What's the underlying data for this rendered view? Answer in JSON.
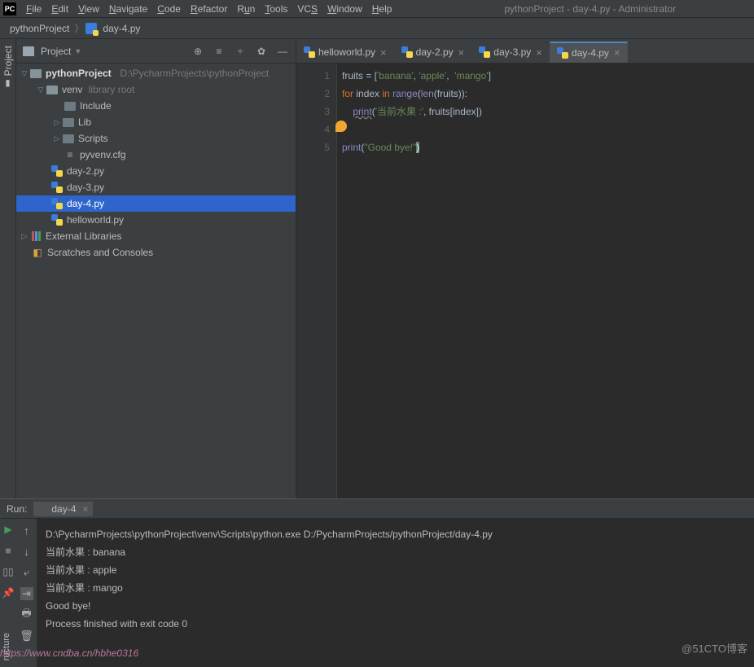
{
  "window_title": "pythonProject - day-4.py - Administrator",
  "menu": [
    "File",
    "Edit",
    "View",
    "Navigate",
    "Code",
    "Refactor",
    "Run",
    "Tools",
    "VCS",
    "Window",
    "Help"
  ],
  "breadcrumb": {
    "root": "pythonProject",
    "file": "day-4.py"
  },
  "project_panel": {
    "title": "Project",
    "root": "pythonProject",
    "root_path": "D:\\PycharmProjects\\pythonProject",
    "venv": "venv",
    "venv_note": "library root",
    "include": "Include",
    "lib": "Lib",
    "scripts": "Scripts",
    "pyvenv": "pyvenv.cfg",
    "files": [
      "day-2.py",
      "day-3.py",
      "day-4.py",
      "helloworld.py"
    ],
    "ext_lib": "External Libraries",
    "scratches": "Scratches and Consoles"
  },
  "tabs": [
    {
      "label": "helloworld.py"
    },
    {
      "label": "day-2.py"
    },
    {
      "label": "day-3.py"
    },
    {
      "label": "day-4.py"
    }
  ],
  "code": {
    "l1_a": "fruits = [",
    "l1_s1": "'banana'",
    "l1_c": ", ",
    "l1_s2": "'apple'",
    "l1_c2": ",  ",
    "l1_s3": "'mango'",
    "l1_b": "]",
    "l2_for": "for",
    "l2_idx": " index ",
    "l2_in": "in",
    "l2_sp": " ",
    "l2_range": "range",
    "l2_p1": "(",
    "l2_len": "len",
    "l2_p2": "(fruits)):",
    "l3_sp": "    ",
    "l3_print": "print",
    "l3_p1": "(",
    "l3_s": "'当前水果 :'",
    "l3_rest": ", fruits[index])",
    "l5_print": "print",
    "l5_p1": "(",
    "l5_s": "\"Good bye!\"",
    "l5_p2": ")"
  },
  "line_numbers": [
    "1",
    "2",
    "3",
    "4",
    "5"
  ],
  "run": {
    "label": "Run:",
    "tab": "day-4",
    "lines": [
      "D:\\PycharmProjects\\pythonProject\\venv\\Scripts\\python.exe D:/PycharmProjects/pythonProject/day-4.py",
      "当前水果 : banana",
      "当前水果 : apple",
      "当前水果 : mango",
      "Good bye!",
      "",
      "Process finished with exit code 0"
    ]
  },
  "sidebar_label": "Project",
  "structure_label": "ructure",
  "footer": "@51CTO博客",
  "watermark": "https://www.cndba.cn/hbhe0316"
}
